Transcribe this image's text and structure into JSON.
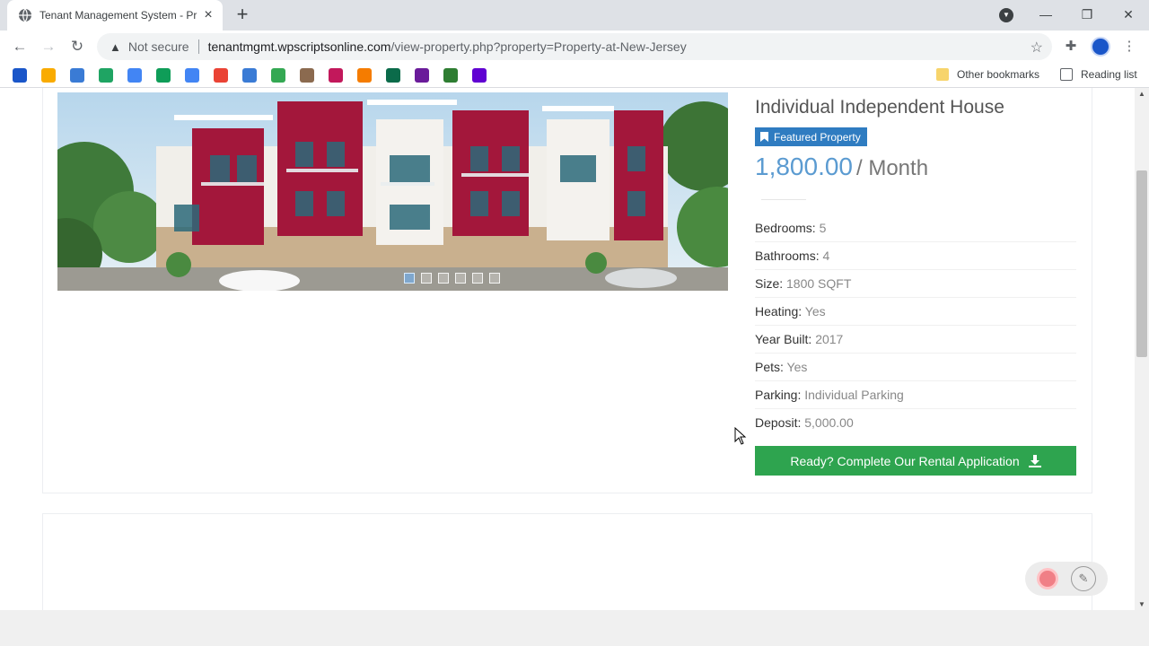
{
  "browser": {
    "tab_title": "Tenant Management System - Pr",
    "new_tab": "+",
    "security_label": "Not secure",
    "url_host": "tenantmgmt.wpscriptsonline.com",
    "url_path": "/view-property.php?property=Property-at-New-Jersey",
    "other_bookmarks": "Other bookmarks",
    "reading_list": "Reading list"
  },
  "bookmarks": [
    {
      "icon": "blue-circle-icon",
      "color": "#1a56c9"
    },
    {
      "icon": "analytics-icon",
      "color": "#f9ab00"
    },
    {
      "icon": "bookmark-app-icon",
      "color": "#3a7bd5"
    },
    {
      "icon": "drive-icon",
      "color": "#1fa463"
    },
    {
      "icon": "docs-icon",
      "color": "#4285f4"
    },
    {
      "icon": "sheets-icon",
      "color": "#0f9d58"
    },
    {
      "icon": "ads-icon",
      "color": "#4285f4"
    },
    {
      "icon": "google-icon",
      "color": "#ea4335"
    },
    {
      "icon": "workflow-icon",
      "color": "#3a7bd5"
    },
    {
      "icon": "trend-icon",
      "color": "#34a853"
    },
    {
      "icon": "avatar-bookmark-icon",
      "color": "#8b6a4f"
    },
    {
      "icon": "stripes-icon",
      "color": "#c2185b"
    },
    {
      "icon": "target-icon",
      "color": "#f57c00"
    },
    {
      "icon": "d-app-icon",
      "color": "#0b6b4a"
    },
    {
      "icon": "slack-icon",
      "color": "#6a1b9a"
    },
    {
      "icon": "feather-icon",
      "color": "#2e7d32"
    },
    {
      "icon": "yahoo-icon",
      "color": "#6001d2"
    }
  ],
  "property": {
    "title": "Individual Independent House",
    "badge": "Featured Property",
    "price": "1,800.00",
    "price_unit": "/ Month",
    "details": [
      {
        "label": "Bedrooms:",
        "value": "5"
      },
      {
        "label": "Bathrooms:",
        "value": "4"
      },
      {
        "label": "Size:",
        "value": "1800 SQFT"
      },
      {
        "label": "Heating:",
        "value": "Yes"
      },
      {
        "label": "Year Built:",
        "value": "2017"
      },
      {
        "label": "Pets:",
        "value": "Yes"
      },
      {
        "label": "Parking:",
        "value": "Individual Parking"
      },
      {
        "label": "Deposit:",
        "value": "5,000.00"
      }
    ],
    "apply_button": "Ready? Complete Our Rental Application",
    "carousel_slides": 6,
    "carousel_active": 1
  },
  "colors": {
    "badge": "#2f7cc1",
    "price": "#5b9bd1",
    "apply_button": "#2ea44f",
    "building_accent": "#a3173b"
  }
}
